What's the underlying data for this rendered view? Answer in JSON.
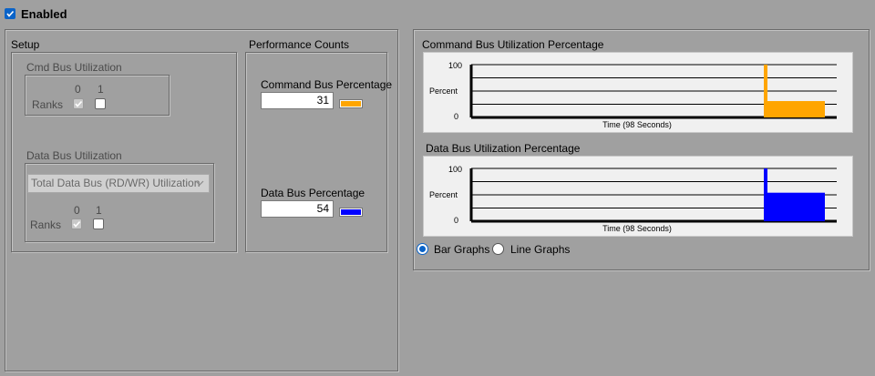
{
  "enabled": {
    "label": "Enabled",
    "checked": true
  },
  "setup": {
    "title": "Setup",
    "cmd_bus": {
      "title": "Cmd Bus Utilization",
      "ranks_label": "Ranks",
      "rank_headers": [
        "0",
        "1"
      ]
    },
    "data_bus": {
      "title": "Data Bus Utilization",
      "select_value": "Total Data Bus (RD/WR) Utilization",
      "ranks_label": "Ranks",
      "rank_headers": [
        "0",
        "1"
      ]
    }
  },
  "performance": {
    "title": "Performance Counts",
    "command": {
      "label": "Command Bus Percentage",
      "value": "31",
      "color": "#ffa500"
    },
    "data": {
      "label": "Data Bus Percentage",
      "value": "54",
      "color": "#0000ff"
    }
  },
  "graphs": {
    "command": {
      "title": "Command Bus Utilization Percentage"
    },
    "data": {
      "title": "Data Bus Utilization Percentage"
    },
    "bar_label": "Bar Graphs",
    "line_label": "Line Graphs",
    "selected": "bar"
  },
  "chart_data": [
    {
      "type": "bar",
      "title": "Command Bus Utilization Percentage",
      "xlabel": "Time (98 Seconds)",
      "ylabel": "Percent",
      "ytick_labels": [
        "100",
        "0"
      ],
      "ylim": [
        0,
        100
      ],
      "series": [
        {
          "color": "#ffa500",
          "spike": 100,
          "values": [
            31
          ]
        }
      ]
    },
    {
      "type": "bar",
      "title": "Data Bus Utilization Percentage",
      "xlabel": "Time (98 Seconds)",
      "ylabel": "Percent",
      "ytick_labels": [
        "100",
        "0"
      ],
      "ylim": [
        0,
        100
      ],
      "series": [
        {
          "color": "#0000ff",
          "spike": 100,
          "values": [
            54
          ]
        }
      ]
    }
  ]
}
